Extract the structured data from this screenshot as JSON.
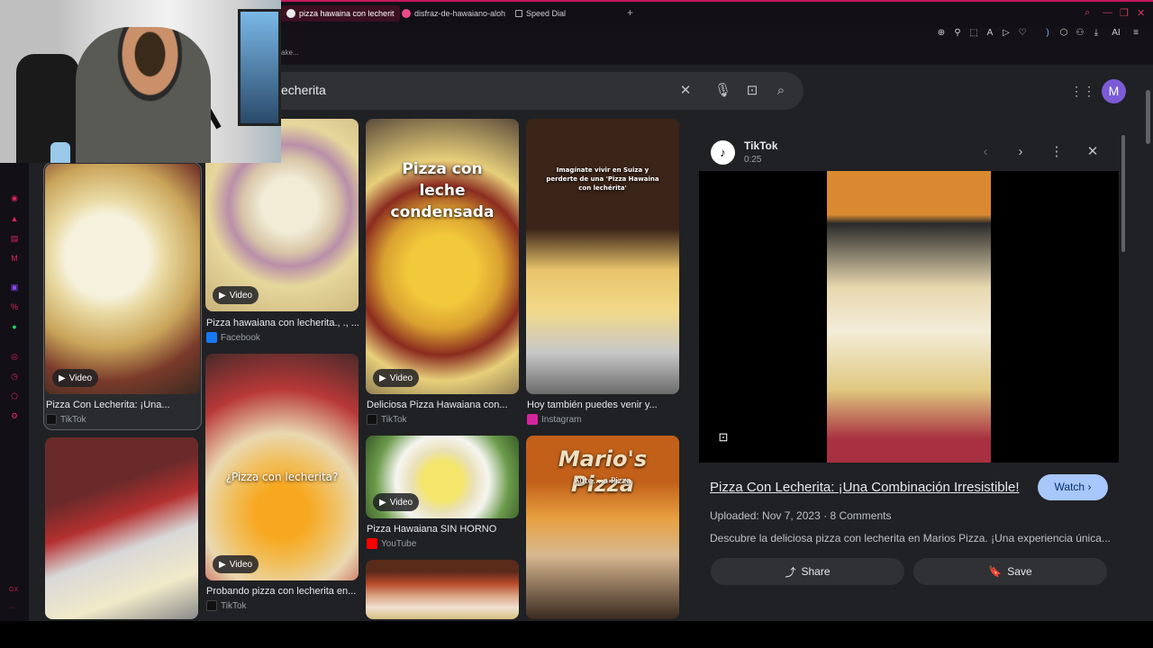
{
  "browser": {
    "tabs": [
      {
        "label": "pizza hawaina con lecherit",
        "active": true
      },
      {
        "label": "disfraz-de-hawaiano-aloh",
        "active": false
      },
      {
        "label": "Speed Dial",
        "active": false
      }
    ],
    "bookmark_fragment": "ake...",
    "toolbar_ai_label": "AI",
    "accent_color": "#c2185b"
  },
  "sidebar": {
    "bottom_label": "GX",
    "bottom_dots": "···"
  },
  "search": {
    "query": "echerita",
    "icons": [
      "clear-icon",
      "mic-icon",
      "lens-icon",
      "search-icon"
    ],
    "avatar_letter": "M",
    "avatar_color": "#7b5bd6"
  },
  "results": [
    {
      "title": "Pizza Con Lecherita: ¡Una...",
      "source": "TikTok",
      "badge": "Video",
      "selected": true
    },
    {
      "title": "Pizza hawaiana con lecherita., ., ...",
      "source": "Facebook",
      "badge": "Video"
    },
    {
      "title": "Deliciosa Pizza Hawaiana con...",
      "source": "TikTok",
      "badge": "Video",
      "overlay": "Pizza con leche condensada"
    },
    {
      "title": "Hoy también puedes venir y...",
      "source": "Instagram",
      "overlay": "Imagínate vivir en Suiza y perderte de una 'Pizza Hawaina con lechérita'"
    },
    {
      "title": "Probando pizza con lecherita en...",
      "source": "TikTok",
      "badge": "Video",
      "overlay": "¿Pizza con lecherita?"
    },
    {
      "title": "Pizza Hawaiana SIN HORNO",
      "source": "YouTube",
      "badge": "Video"
    },
    {
      "sign": "Mario's Pizza",
      "sign_sub": "Auté... a Pizza"
    }
  ],
  "preview": {
    "source": "TikTok",
    "duration": "0:25",
    "title": "Pizza Con Lecherita: ¡Una Combinación Irresistible!",
    "watch_label": "Watch",
    "uploaded": "Uploaded: Nov 7, 2023",
    "comments": "8 Comments",
    "description": "Descubre la deliciosa pizza con lecherita en Marios Pizza. ¡Una experiencia única...",
    "share_label": "Share",
    "save_label": "Save"
  }
}
